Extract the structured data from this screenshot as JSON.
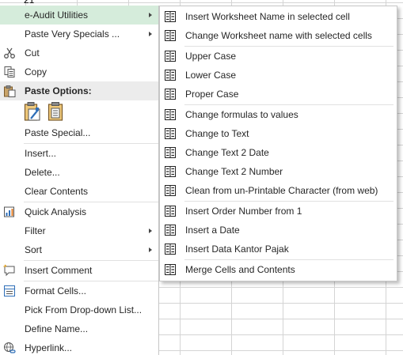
{
  "sheet": {
    "cell_peek": "21"
  },
  "context_menu": {
    "items": [
      {
        "label": "e-Audit Utilities",
        "submenu": true,
        "icon": "none",
        "highlighted": true
      },
      {
        "label": "Paste Very Specials ...",
        "submenu": true,
        "icon": "none"
      },
      {
        "label": "Cut",
        "icon": "scissors-icon"
      },
      {
        "label": "Copy",
        "icon": "copy-icon"
      },
      {
        "label": "Paste Options:",
        "icon": "clipboard-icon",
        "header": true
      },
      {
        "label": "Paste Special...",
        "icon": "none"
      },
      {
        "label": "Insert...",
        "icon": "none"
      },
      {
        "label": "Delete...",
        "icon": "none"
      },
      {
        "label": "Clear Contents",
        "icon": "none"
      },
      {
        "label": "Quick Analysis",
        "icon": "quick-analysis-icon"
      },
      {
        "label": "Filter",
        "submenu": true,
        "icon": "none"
      },
      {
        "label": "Sort",
        "submenu": true,
        "icon": "none"
      },
      {
        "label": "Insert Comment",
        "icon": "comment-icon"
      },
      {
        "label": "Format Cells...",
        "icon": "format-cells-icon"
      },
      {
        "label": "Pick From Drop-down List...",
        "icon": "none"
      },
      {
        "label": "Define Name...",
        "icon": "none"
      },
      {
        "label": "Hyperlink...",
        "icon": "hyperlink-icon"
      }
    ],
    "paste_option_icons": [
      "paste-formatting-icon",
      "paste-icon"
    ]
  },
  "submenu": {
    "items": [
      {
        "label": "Insert Worksheet Name in selected cell"
      },
      {
        "label": "Change Worksheet name with selected cells"
      },
      {
        "label": "Upper Case"
      },
      {
        "label": "Lower Case"
      },
      {
        "label": "Proper Case"
      },
      {
        "label": "Change formulas to values"
      },
      {
        "label": "Change to Text"
      },
      {
        "label": "Change Text 2 Date"
      },
      {
        "label": "Change Text 2 Number"
      },
      {
        "label": "Clean from un-Printable Character (from web)"
      },
      {
        "label": "Insert Order Number from 1"
      },
      {
        "label": "Insert a Date"
      },
      {
        "label": "Insert Data Kantor Pajak"
      },
      {
        "label": "Merge Cells and Contents"
      }
    ],
    "item_icon": "macro-grid-icon"
  },
  "colors": {
    "highlight": "#d5ecdb",
    "header_bg": "#ececec",
    "separator": "#e1e1e1"
  }
}
